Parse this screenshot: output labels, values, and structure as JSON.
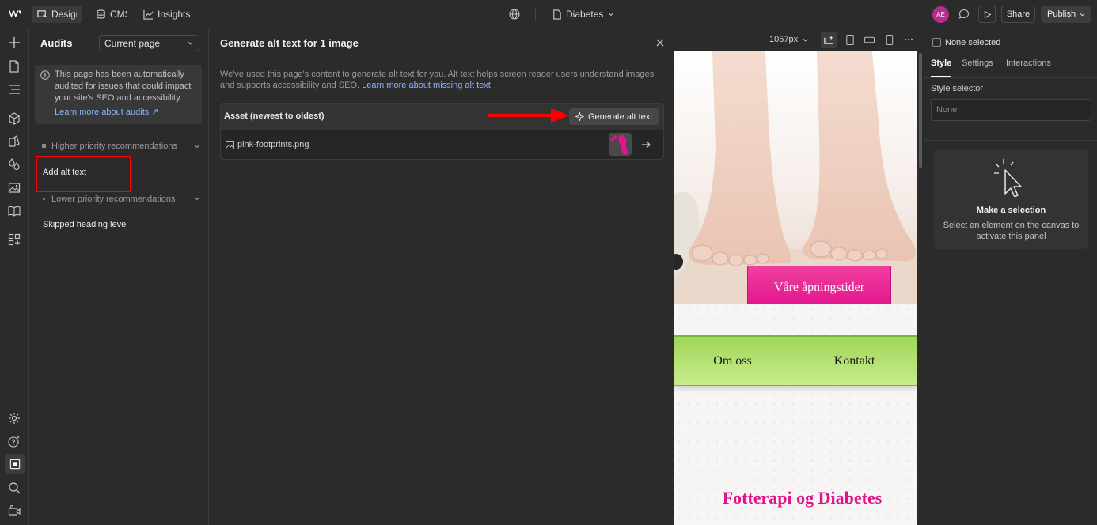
{
  "topbar": {
    "design_label": "Design",
    "cms_label": "CMS",
    "insights_label": "Insights",
    "page_name": "Diabetes",
    "avatar_initials": "AE",
    "share_label": "Share",
    "publish_label": "Publish"
  },
  "audits": {
    "title": "Audits",
    "scope_select": "Current page",
    "info_text": "This page has been automatically audited for issues that could impact your site's SEO and accessibility.",
    "info_link": "Learn more about audits ↗",
    "higher_label": "Higher priority recommendations",
    "higher_items": [
      "Add alt text"
    ],
    "lower_label": "Lower priority recommendations",
    "lower_items": [
      "Skipped heading level"
    ]
  },
  "modal": {
    "title": "Generate alt text for 1 image",
    "description": "We've used this page's content to generate alt text for you. Alt text helps screen reader users understand images and supports accessibility and SEO.",
    "description_link": "Learn more about missing alt text",
    "column_header": "Asset (newest to oldest)",
    "generate_button": "Generate alt text",
    "assets": [
      {
        "filename": "pink-footprints.png"
      }
    ]
  },
  "canvas": {
    "width_label": "1057px",
    "hours_button": "Våre åpningstider",
    "nav_items": [
      "Om oss",
      "Kontakt"
    ],
    "heading": "Fotterapi og Diabetes"
  },
  "right_panel": {
    "none_selected": "None selected",
    "tabs": [
      "Style",
      "Settings",
      "Interactions"
    ],
    "style_selector_label": "Style selector",
    "style_selector_value": "None",
    "empty_title": "Make a selection",
    "empty_text": "Select an element on the canvas to activate this panel"
  },
  "colors": {
    "accent_pink": "#e8168f",
    "nav_green": "#9fd65a",
    "annotation_red": "#ff0000",
    "link_blue": "#8ab4f8"
  }
}
